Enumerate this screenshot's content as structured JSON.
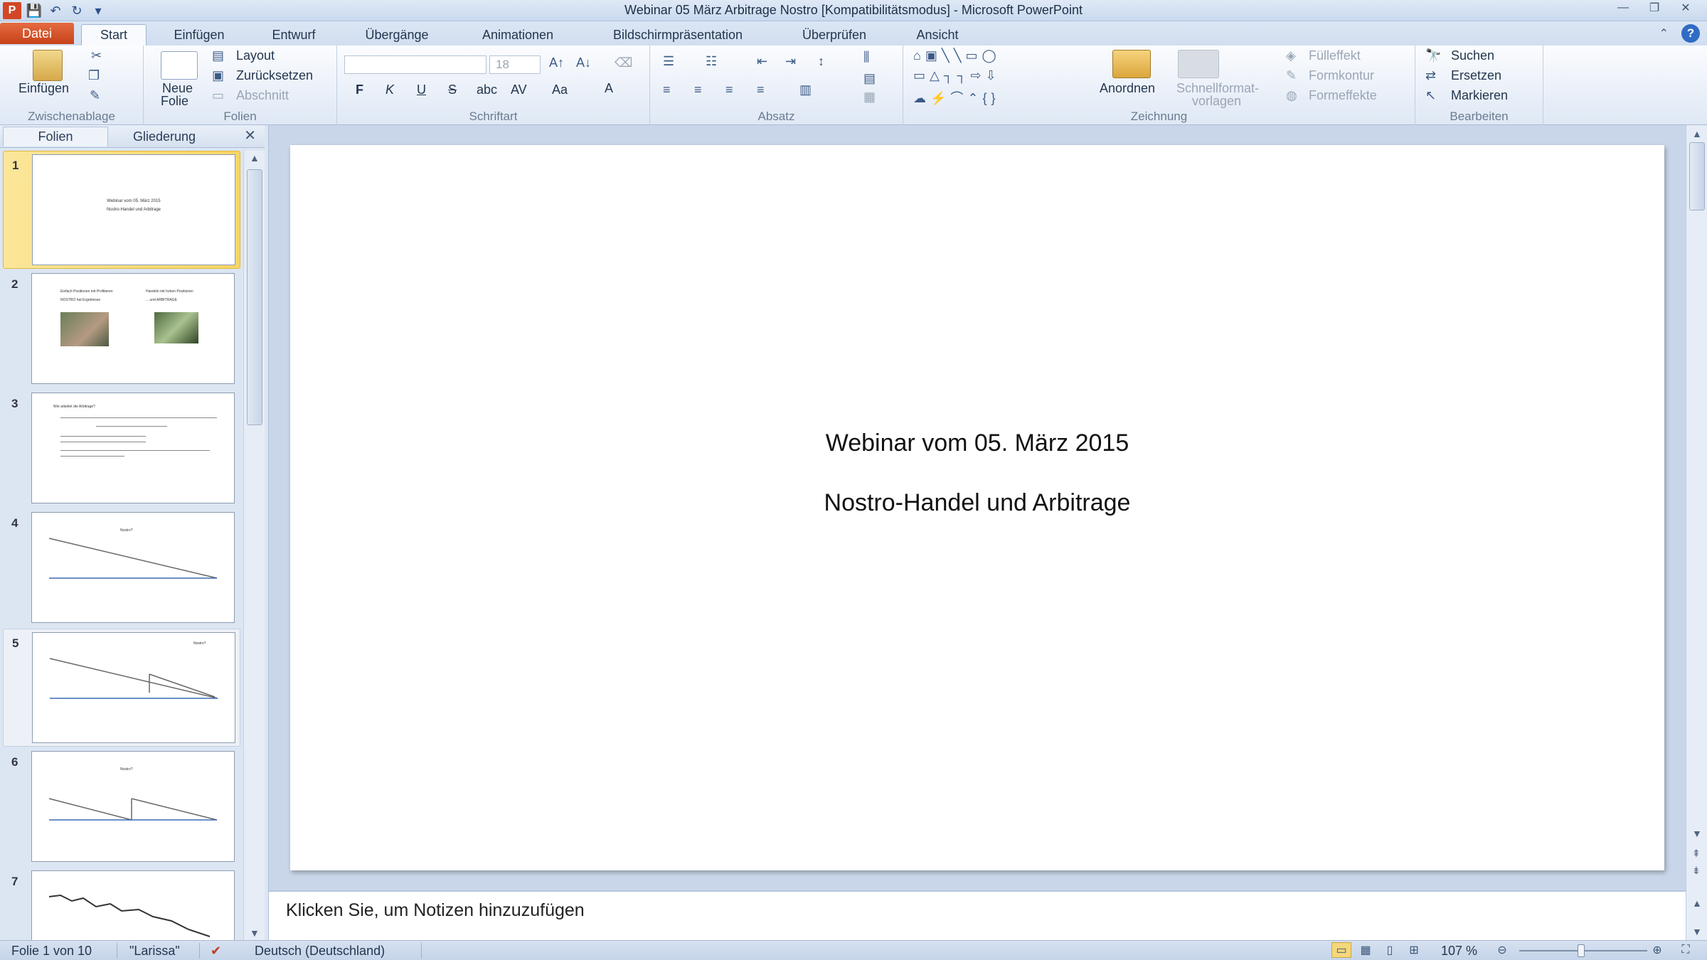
{
  "window": {
    "title": "Webinar 05 März Arbitrage Nostro [Kompatibilitätsmodus]  -  Microsoft PowerPoint",
    "app_icon": "P",
    "controls": {
      "minimize": "—",
      "restore": "❐",
      "close": "✕"
    }
  },
  "qat": {
    "save": "💾",
    "undo": "↶",
    "redo": "↻",
    "customize": "▾"
  },
  "tabs": {
    "file": "Datei",
    "items": [
      "Start",
      "Einfügen",
      "Entwurf",
      "Übergänge",
      "Animationen",
      "Bildschirmpräsentation",
      "Überprüfen",
      "Ansicht"
    ],
    "active": "Start"
  },
  "ribbon": {
    "clipboard": {
      "label": "Zwischenablage",
      "paste": "Einfügen"
    },
    "slides": {
      "label": "Folien",
      "new_slide": "Neue",
      "new_slide2": "Folie",
      "layout": "Layout",
      "reset": "Zurücksetzen",
      "section": "Abschnitt"
    },
    "font": {
      "label": "Schriftart",
      "size": "18",
      "bold": "F",
      "italic": "K",
      "underline": "U",
      "strike": "S",
      "shadow": "abc",
      "spacing": "AV",
      "case": "Aa",
      "color": "A"
    },
    "paragraph": {
      "label": "Absatz"
    },
    "drawing": {
      "label": "Zeichnung",
      "arrange": "Anordnen",
      "quickstyles": "Schnellformat-",
      "quickstyles2": "vorlagen",
      "fill": "Fülleffekt",
      "outline": "Formkontur",
      "effects": "Formeffekte"
    },
    "editing": {
      "label": "Bearbeiten",
      "find": "Suchen",
      "replace": "Ersetzen",
      "select": "Markieren"
    }
  },
  "leftpane": {
    "tabs": [
      "Folien",
      "Gliederung"
    ],
    "close": "✕"
  },
  "slides": [
    {
      "num": "1",
      "text1": "Webinar vom 05. März 2015",
      "text2": "Nostro-Handel und Arbitrage"
    },
    {
      "num": "2",
      "text1": "Einfach Positionen mit Profitieren",
      "text2": "Handeln mit hohen Positionen",
      "text3": "NOSTRO hat Ergebnisse",
      "text4": "... und ARBITRAGE"
    },
    {
      "num": "3",
      "text1": "Wie arbeitet die Arbitrage?"
    },
    {
      "num": "4",
      "text1": "Nostro?"
    },
    {
      "num": "5",
      "text1": "Nostro?"
    },
    {
      "num": "6",
      "text1": "Nostro?"
    },
    {
      "num": "7"
    }
  ],
  "main_slide": {
    "title": "Webinar vom 05. März 2015",
    "subtitle": "Nostro-Handel und Arbitrage"
  },
  "notes": {
    "placeholder": "Klicken Sie, um Notizen hinzuzufügen"
  },
  "status": {
    "slide": "Folie 1 von 10",
    "theme": "\"Larissa\"",
    "language": "Deutsch (Deutschland)",
    "zoom": "107 %"
  },
  "colors": {
    "file_tab": "#d24726",
    "selection": "#f7d663",
    "accent": "#2f6cc4"
  }
}
